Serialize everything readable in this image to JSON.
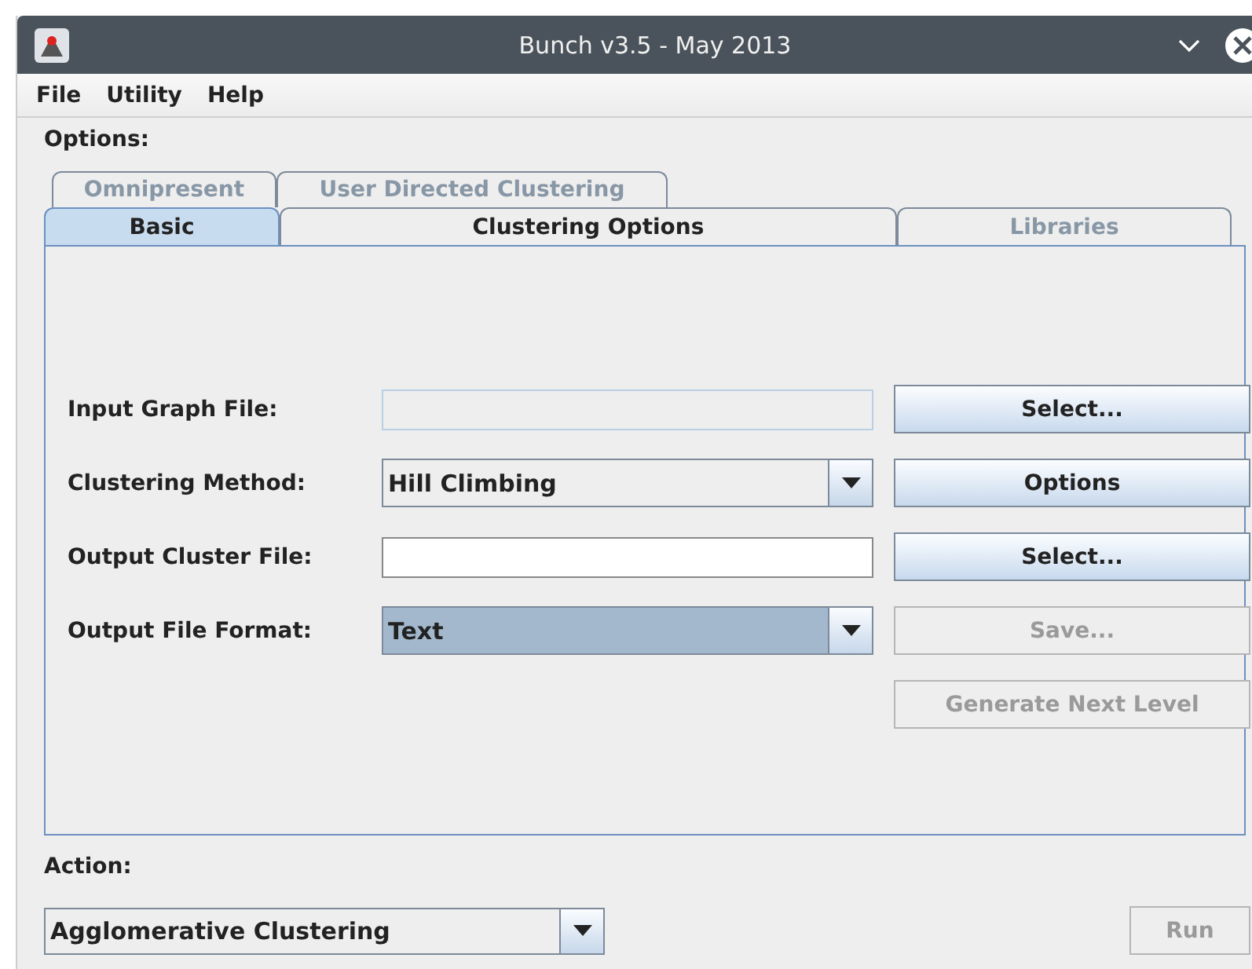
{
  "window": {
    "title": "Bunch v3.5 - May 2013"
  },
  "menu": [
    "File",
    "Utility",
    "Help"
  ],
  "options_label": "Options:",
  "tab_rows": [
    [
      {
        "label": "Omnipresent",
        "selected": false,
        "disabled": true
      },
      {
        "label": "User Directed Clustering",
        "selected": false,
        "disabled": true
      }
    ],
    [
      {
        "label": "Basic",
        "selected": true,
        "disabled": false
      },
      {
        "label": "Clustering Options",
        "selected": false,
        "disabled": false
      },
      {
        "label": "Libraries",
        "selected": false,
        "disabled": true
      }
    ]
  ],
  "form": [
    {
      "label": "Input Graph File:",
      "kind": "text",
      "disabled": true,
      "button": {
        "label": "Select...",
        "disabled": false
      }
    },
    {
      "label": "Clustering Method:",
      "kind": "combo",
      "value": "Hill Climbing",
      "highlighted": false,
      "button": {
        "label": "Options",
        "disabled": false
      }
    },
    {
      "label": "Output Cluster File:",
      "kind": "text",
      "disabled": false,
      "button": {
        "label": "Select...",
        "disabled": false
      }
    },
    {
      "label": "Output File Format:",
      "kind": "combo",
      "value": "Text",
      "highlighted": true,
      "button": {
        "label": "Save...",
        "disabled": true
      }
    },
    {
      "kind": "none",
      "button": {
        "label": "Generate Next Level",
        "disabled": true
      }
    }
  ],
  "action": {
    "label": "Action:",
    "value": "Agglomerative Clustering",
    "button": {
      "label": "Run",
      "disabled": true
    }
  }
}
